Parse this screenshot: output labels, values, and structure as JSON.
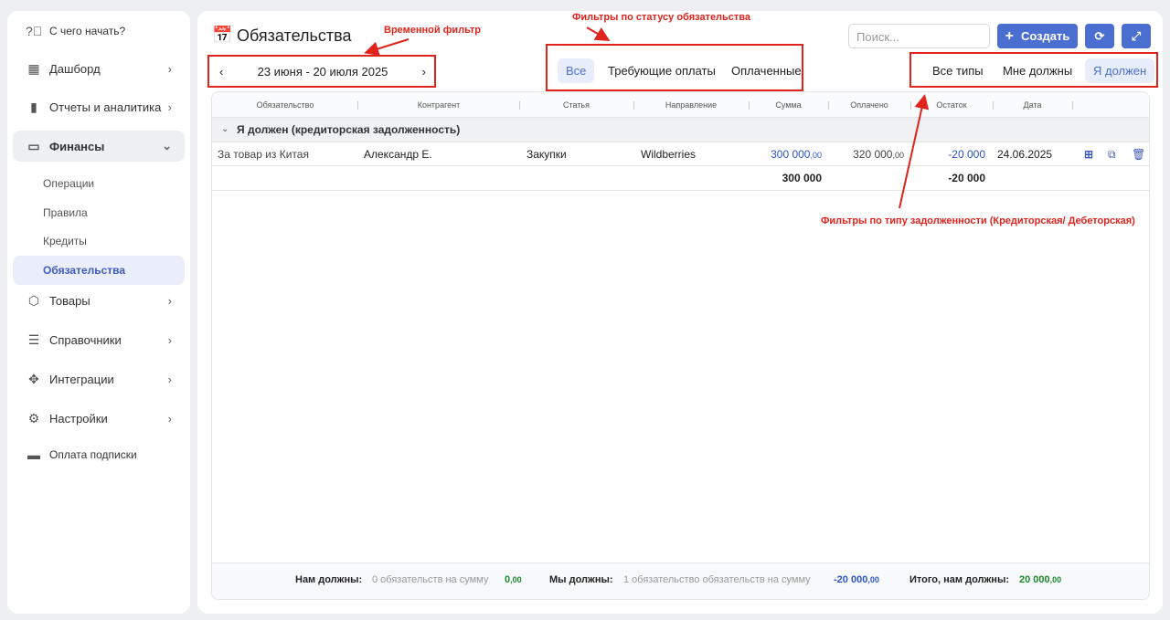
{
  "sidebar": {
    "items": [
      {
        "label": "С чего начать?",
        "icon": "help-circle-icon"
      },
      {
        "label": "Дашборд",
        "icon": "dashboard-icon"
      },
      {
        "label": "Отчеты и аналитика",
        "icon": "bar-chart-icon"
      },
      {
        "label": "Финансы",
        "icon": "finance-icon"
      },
      {
        "label": "Товары",
        "icon": "box-icon"
      },
      {
        "label": "Справочники",
        "icon": "list-icon"
      },
      {
        "label": "Интеграции",
        "icon": "integration-icon"
      },
      {
        "label": "Настройки",
        "icon": "gear-icon"
      },
      {
        "label": "Оплата подписки",
        "icon": "card-icon"
      }
    ],
    "finance_sub": [
      "Операции",
      "Правила",
      "Кредиты",
      "Обязательства"
    ]
  },
  "header": {
    "title": "Обязательства",
    "search_placeholder": "Поиск...",
    "create_label": "Создать"
  },
  "period": {
    "label": "23 июня - 20 июля 2025"
  },
  "status_filters": [
    "Все",
    "Требующие оплаты",
    "Оплаченные"
  ],
  "type_filters": [
    "Все типы",
    "Мне должны",
    "Я должен"
  ],
  "annotations": {
    "time": "Временной фильтр",
    "status": "Фильтры по статусу обязательства",
    "type": "Фильтры по типу задолженности (Кредиторская/ Дебеторская)"
  },
  "table": {
    "columns": [
      "Обязательство",
      "Контрагент",
      "Статья",
      "Направление",
      "Сумма",
      "Оплачено",
      "Остаток",
      "Дата"
    ],
    "group": "Я должен (кредиторская задолженность)",
    "rows": [
      {
        "name": "За товар из Китая",
        "counterparty": "Александр Е.",
        "article": "Закупки",
        "direction": "Wildberries",
        "sum": "300 000",
        "sum_dec": ",00",
        "paid": "320 000",
        "paid_dec": ",00",
        "rest": "-20 000",
        "date": "24.06.2025"
      }
    ],
    "totals": {
      "sum": "300 000",
      "rest": "-20 000"
    }
  },
  "footer": {
    "owed_to_us_label": "Нам должны:",
    "owed_to_us_text": "0 обязательств на сумму",
    "owed_to_us_value": "0",
    "owed_to_us_dec": ",00",
    "we_owe_label": "Мы должны:",
    "we_owe_text": "1 обязательство обязательств на сумму",
    "we_owe_value": "-20 000",
    "we_owe_dec": ",00",
    "total_label": "Итого, нам должны:",
    "total_value": "20 000",
    "total_dec": ",00"
  },
  "colors": {
    "accent": "#4a6fd0",
    "annotation": "#e0231b"
  }
}
